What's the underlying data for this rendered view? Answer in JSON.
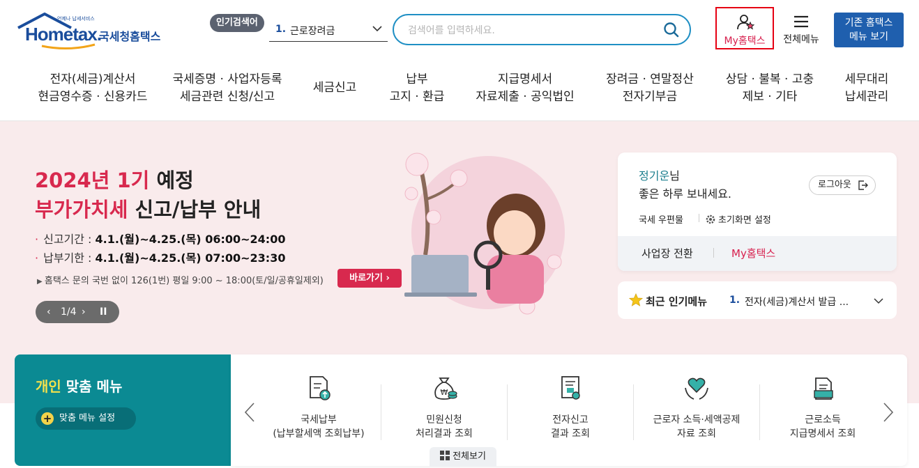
{
  "header": {
    "logo_brand": "Hometax.",
    "logo_tagline": "언제나 납세서비스",
    "logo_korean": "국세청홈택스",
    "popular_badge": "인기검색어",
    "popular_num": "1.",
    "popular_term": "근로장려금",
    "search_placeholder": "검색어를 입력하세요.",
    "my_hometax": "My홈택스",
    "full_menu": "전체메뉴",
    "legacy_line1": "기존 홈택스",
    "legacy_line2": "메뉴 보기"
  },
  "gnb": [
    {
      "line1": "전자(세금)계산서",
      "line2": "현금영수증 · 신용카드"
    },
    {
      "line1": "국세증명 · 사업자등록",
      "line2": "세금관련 신청/신고"
    },
    {
      "line1": "세금신고",
      "line2": ""
    },
    {
      "line1": "납부",
      "line2": "고지 · 환급"
    },
    {
      "line1": "지급명세서",
      "line2": "자료제출 · 공익법인"
    },
    {
      "line1": "장려금 · 연말정산",
      "line2": "전자기부금"
    },
    {
      "line1": "상담 · 불복 · 고충",
      "line2": "제보 · 기타"
    },
    {
      "line1": "세무대리",
      "line2": "납세관리"
    }
  ],
  "hero": {
    "title1_red": "2024년 1기",
    "title1_black": "예정",
    "title2_red": "부가가치세",
    "title2_black": "신고/납부 안내",
    "line1_label": "신고기간 :",
    "line1_value": "4.1.(월)~4.25.(목) 06:00~24:00",
    "line2_label": "납부기한 :",
    "line2_value": "4.1.(월)~4.25.(목) 07:00~23:30",
    "note": "홈택스 문의 국번 없이 126(1번) 평일 9:00 ~ 18:00(토/일/공휴일제외)",
    "go_button": "바로가기",
    "pager": "1/4"
  },
  "login": {
    "user_name": "정기운",
    "honorific": "님",
    "greeting": "좋은 하루 보내세요.",
    "logout": "로그아웃",
    "mailbox": "국세 우편물",
    "settings": "초기화면 설정",
    "biz_switch": "사업장 전환",
    "my_hometax": "My홈택스"
  },
  "recent": {
    "title": "최근 인기메뉴",
    "num": "1.",
    "item": "전자(세금)계산서 발급 ..."
  },
  "custom_menu": {
    "title_highlight": "개인",
    "title_rest": "맞춤 메뉴",
    "settings_button": "맞춤 메뉴 설정",
    "tiles": [
      {
        "line1": "국세납부",
        "line2": "(납부할세액 조회납부)",
        "icon": "tax-payment-icon"
      },
      {
        "line1": "민원신청",
        "line2": "처리결과 조회",
        "icon": "money-bag-icon"
      },
      {
        "line1": "전자신고",
        "line2": "결과 조회",
        "icon": "certificate-icon"
      },
      {
        "line1": "근로자 소득·세액공제",
        "line2": "자료 조회",
        "icon": "heart-hands-icon"
      },
      {
        "line1": "근로소득",
        "line2": "지급명세서 조회",
        "icon": "document-stack-icon"
      }
    ],
    "all_view": "전체보기"
  },
  "colors": {
    "primary": "#1a4d9c",
    "accent_red": "#d8294e",
    "teal": "#0b8a93",
    "hero_bg": "#f9ebec"
  }
}
